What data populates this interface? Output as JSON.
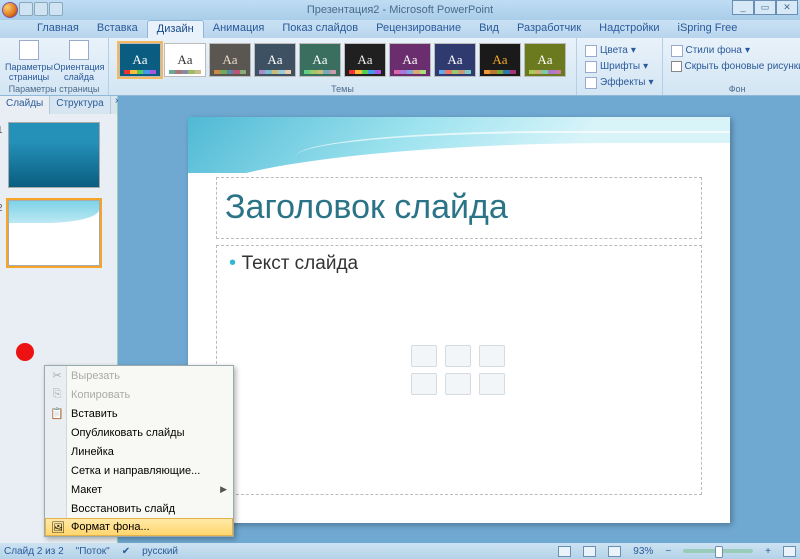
{
  "window": {
    "title": "Презентация2 - Microsoft PowerPoint"
  },
  "tabs": [
    "Главная",
    "Вставка",
    "Дизайн",
    "Анимация",
    "Показ слайдов",
    "Рецензирование",
    "Вид",
    "Разработчик",
    "Надстройки",
    "iSpring Free"
  ],
  "active_tab": 2,
  "ribbon": {
    "page_group": {
      "params": "Параметры\nстраницы",
      "orient": "Ориентация\nслайда",
      "label": "Параметры страницы"
    },
    "themes_label": "Темы",
    "themes": [
      {
        "bg": "#0a5d80",
        "fg": "#fff",
        "bar": [
          "#e33",
          "#fb3",
          "#5c5",
          "#49e",
          "#a5d"
        ]
      },
      {
        "bg": "#fff",
        "fg": "#333",
        "bar": [
          "#6a9",
          "#a77",
          "#88a",
          "#9b6",
          "#cb8"
        ]
      },
      {
        "bg": "#5a5753",
        "fg": "#e7dcc8",
        "bar": [
          "#c84",
          "#7a5",
          "#58a",
          "#b57",
          "#8a7"
        ]
      },
      {
        "bg": "#3d5163",
        "fg": "#fff",
        "bar": [
          "#a8c",
          "#7bc",
          "#cb7",
          "#9cd",
          "#eca"
        ]
      },
      {
        "bg": "#3a6e5e",
        "fg": "#fff",
        "bar": [
          "#6c8",
          "#9c6",
          "#cb7",
          "#7ab",
          "#c9a"
        ]
      },
      {
        "bg": "#202020",
        "fg": "#eee",
        "bar": [
          "#e33",
          "#fb3",
          "#5c5",
          "#49e",
          "#a5d"
        ]
      },
      {
        "bg": "#6a2d6d",
        "fg": "#fff",
        "bar": [
          "#d6a",
          "#a7d",
          "#7ad",
          "#da7",
          "#ad7"
        ]
      },
      {
        "bg": "#2f3a6e",
        "fg": "#fff",
        "bar": [
          "#6ae",
          "#e76",
          "#9c6",
          "#c97",
          "#7cc"
        ]
      },
      {
        "bg": "#1a1a1a",
        "fg": "#f3a828",
        "bar": [
          "#e93",
          "#b73",
          "#7a3",
          "#37a",
          "#a37"
        ]
      },
      {
        "bg": "#6b7a1f",
        "fg": "#fff",
        "bar": [
          "#ac5",
          "#ca7",
          "#7ca",
          "#a7c",
          "#c7a"
        ]
      }
    ],
    "theme_opts": {
      "colors": "Цвета",
      "fonts": "Шрифты",
      "effects": "Эффекты"
    },
    "background": {
      "styles": "Стили фона",
      "hide": "Скрыть фоновые рисунки",
      "label": "Фон"
    }
  },
  "panel": {
    "tab_slides": "Слайды",
    "tab_outline": "Структура"
  },
  "slide": {
    "title": "Заголовок слайда",
    "body": "Текст слайда"
  },
  "context_menu": [
    {
      "icon": "✂",
      "label": "Вырезать",
      "disabled": true
    },
    {
      "icon": "⎘",
      "label": "Копировать",
      "disabled": true
    },
    {
      "icon": "📋",
      "label": "Вставить"
    },
    {
      "icon": "",
      "label": "Опубликовать слайды"
    },
    {
      "icon": "",
      "label": "Линейка"
    },
    {
      "icon": "",
      "label": "Сетка и направляющие..."
    },
    {
      "icon": "",
      "label": "Макет",
      "submenu": true
    },
    {
      "icon": "",
      "label": "Восстановить слайд"
    },
    {
      "icon": "🖼",
      "label": "Формат фона...",
      "highlight": true
    }
  ],
  "status": {
    "slide_info": "Слайд 2 из 2",
    "theme": "\"Поток\"",
    "lang": "русский",
    "zoom": "93%"
  }
}
